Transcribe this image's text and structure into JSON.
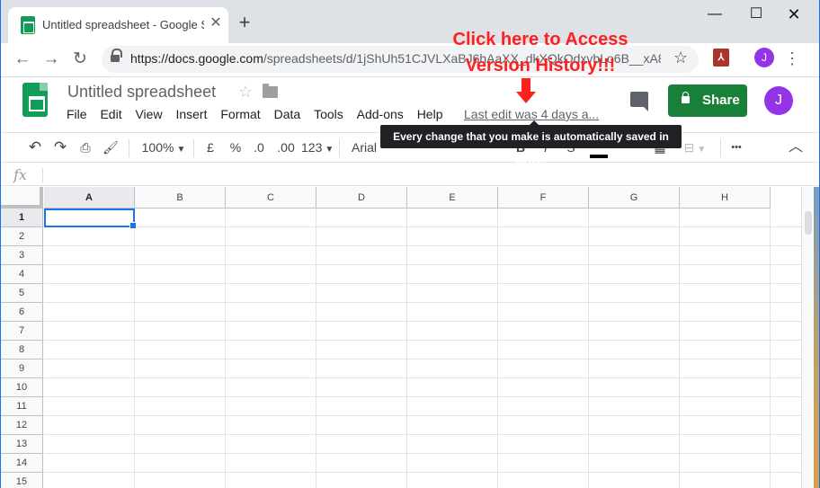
{
  "browser": {
    "tab_title": "Untitled spreadsheet - Google Sh",
    "tab_close": "✕",
    "new_tab": "+",
    "window_minimize": "—",
    "window_maximize": "☐",
    "window_close": "✕",
    "url_host": "https://docs.google.com",
    "url_path": "/spreadsheets/d/1jShUh51CJVLXaBJ6hAaXX_dkXQkOdxvbLo6B__xA8...",
    "profile_initial": "J"
  },
  "sheets": {
    "doc_title": "Untitled spreadsheet",
    "menu": [
      "File",
      "Edit",
      "View",
      "Insert",
      "Format",
      "Data",
      "Tools",
      "Add-ons",
      "Help"
    ],
    "last_edit": "Last edit was 4 days a...",
    "share_label": "Share",
    "avatar_initial": "J"
  },
  "annotation": {
    "line1": "Click here to Access",
    "line2": "Version History!!!",
    "color": "#ff1f1f"
  },
  "toolbar": {
    "zoom": "100%",
    "currency": "£",
    "percent": "%",
    "decrease_decimal": ".0",
    "increase_decimal": ".00",
    "number_format": "123",
    "font": "Arial",
    "bold": "B",
    "italic": "I",
    "strikethrough": "S",
    "more": "•••"
  },
  "tooltip": "Every change that you make is automatically saved in Drive.",
  "formula_bar": {
    "fx": "fx"
  },
  "grid": {
    "columns": [
      "A",
      "B",
      "C",
      "D",
      "E",
      "F",
      "G",
      "H"
    ],
    "rows": [
      "1",
      "2",
      "3",
      "4",
      "5",
      "6",
      "7",
      "8",
      "9",
      "10",
      "11",
      "12",
      "13",
      "14",
      "15"
    ],
    "selected_cell": "A1"
  },
  "colors": {
    "share_green": "#188038",
    "selection_blue": "#1a73e8",
    "avatar_purple": "#9334e6"
  }
}
